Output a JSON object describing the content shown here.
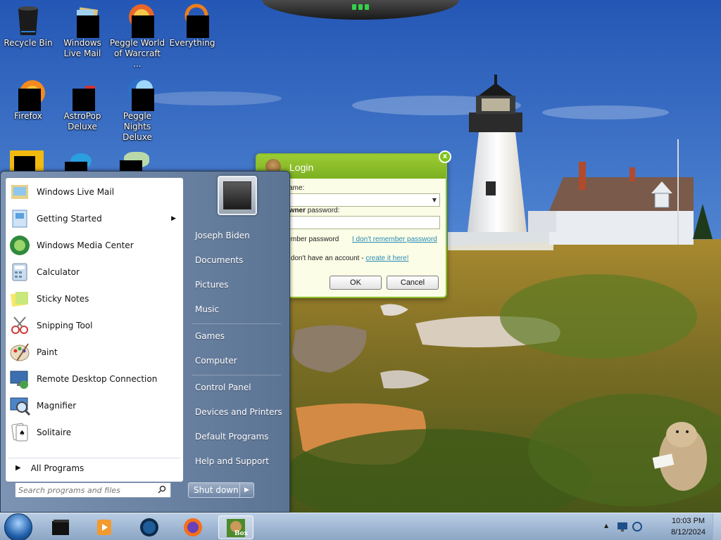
{
  "desktop": {
    "icons": [
      {
        "label": "Recycle Bin"
      },
      {
        "label": "Windows Live Mail"
      },
      {
        "label": "Peggle World of Warcraft ..."
      },
      {
        "label": "Everything"
      },
      {
        "label": "Firefox"
      },
      {
        "label": "AstroPop Deluxe"
      },
      {
        "label": "Peggle Nights Deluxe"
      }
    ]
  },
  "login": {
    "title": "Login",
    "account_label": "t name:",
    "password_label_prefix": "t ",
    "password_label_bold": "owner",
    "password_label_suffix": " password:",
    "remember": "member password",
    "forgot": "I don't remember password",
    "account_text": "ou don't have an account - ",
    "create_link": "create it here!",
    "ok": "OK",
    "cancel": "Cancel",
    "close": "x"
  },
  "start_menu": {
    "programs": [
      {
        "label": "Windows Live Mail",
        "icon": "mail-icon"
      },
      {
        "label": "Getting Started",
        "icon": "getting-started-icon",
        "submenu": true
      },
      {
        "label": "Windows Media Center",
        "icon": "media-center-icon"
      },
      {
        "label": "Calculator",
        "icon": "calculator-icon"
      },
      {
        "label": "Sticky Notes",
        "icon": "sticky-notes-icon"
      },
      {
        "label": "Snipping Tool",
        "icon": "scissors-icon"
      },
      {
        "label": "Paint",
        "icon": "palette-icon"
      },
      {
        "label": "Remote Desktop Connection",
        "icon": "remote-desktop-icon"
      },
      {
        "label": "Magnifier",
        "icon": "magnifier-icon"
      },
      {
        "label": "Solitaire",
        "icon": "cards-icon"
      }
    ],
    "all_programs": "All Programs",
    "search_placeholder": "Search programs and files",
    "right_links": [
      "Joseph Biden",
      "Documents",
      "Pictures",
      "Music",
      "Games",
      "Computer",
      "Control Panel",
      "Devices and Printers",
      "Default Programs",
      "Help and Support"
    ],
    "shutdown": "Shut down"
  },
  "taskbar": {
    "active_label": "Box",
    "time": "10:03 PM",
    "date": "8/12/2024"
  }
}
